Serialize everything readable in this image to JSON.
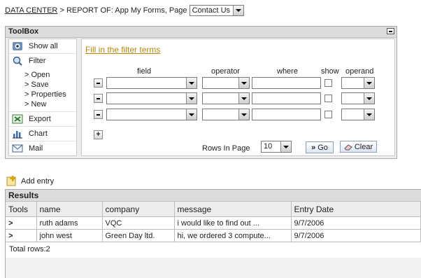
{
  "breadcrumb": {
    "root": "DATA CENTER",
    "separator": ">",
    "report_prefix": "REPORT OF:",
    "report_name": "App My Forms, Page",
    "page_select": "Contact Us"
  },
  "toolbox": {
    "title": "ToolBox",
    "menu": {
      "show_all": "Show all",
      "filter": "Filter",
      "sub_items": [
        "Open",
        "Save",
        "Properties",
        "New"
      ],
      "export": "Export",
      "chart": "Chart",
      "mail": "Mail"
    },
    "filter": {
      "link": "Fill in the filter terms",
      "headers": {
        "field": "field",
        "operator": "operator",
        "where": "where",
        "show": "show",
        "operand": "operand"
      },
      "rows_label": "Rows In Page",
      "rows_value": "10",
      "go_label": "Go",
      "clear_label": "Clear"
    }
  },
  "add_entry": "Add entry",
  "results": {
    "title": "Results",
    "columns": [
      "Tools",
      "name",
      "company",
      "message",
      "Entry Date"
    ],
    "rows": [
      {
        "tool": ">",
        "name": "ruth adams",
        "company": "VQC",
        "message": "i would like to find out ...",
        "date": "9/7/2006"
      },
      {
        "tool": ">",
        "name": "john west",
        "company": "Green Day ltd.",
        "message": "hi, we ordered 3 compute...",
        "date": "9/7/2006"
      }
    ],
    "total": "Total rows:2"
  },
  "colors": {
    "link_orange": "#b8860b",
    "panel_bg": "#ededed",
    "header_bg": "#dcdcdc"
  }
}
